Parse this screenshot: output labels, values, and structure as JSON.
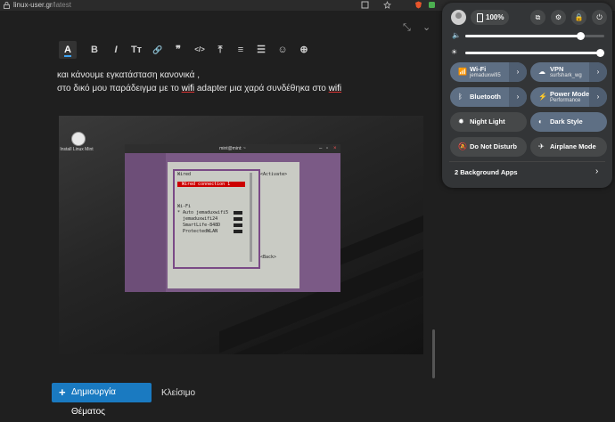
{
  "browser": {
    "url_host": "linux-user.gr",
    "url_path": "/latest"
  },
  "editor": {
    "toolbar": [
      {
        "name": "heading-button",
        "glyph": "A",
        "active": true
      },
      {
        "name": "bold-button",
        "glyph": "B"
      },
      {
        "name": "italic-button",
        "glyph": "I"
      },
      {
        "name": "font-size-button",
        "glyph": "Tт"
      },
      {
        "name": "link-button",
        "glyph": "🔗"
      },
      {
        "name": "quote-button",
        "glyph": "❞"
      },
      {
        "name": "code-button",
        "glyph": "</>"
      },
      {
        "name": "upload-button",
        "glyph": "⤒"
      },
      {
        "name": "bullet-list-button",
        "glyph": "≡"
      },
      {
        "name": "numbered-list-button",
        "glyph": "☰"
      },
      {
        "name": "emoji-button",
        "glyph": "☺"
      },
      {
        "name": "more-button",
        "glyph": "⊕"
      }
    ],
    "line1": "και κάνουμε εγκατάσταση κανονικά  ,",
    "line2_prefix": "στο δικό μου παράδειγμα με το ",
    "line2_link1": "wifi",
    "line2_mid": " adapter μια χαρά συνδέθηκα στο ",
    "line2_link2": "wifi"
  },
  "screenshot": {
    "desktop_icon_label": "Install Linux Mint",
    "terminal_title": "mint@mint: ~",
    "tui_wired": "Wired",
    "tui_selected": "Wired connection 1",
    "tui_activate": "<Activate>",
    "tui_wifi_header": "Wi-Fi",
    "tui_networks": [
      "* Auto jemaduxwifi5",
      "  jemaduxwifi24",
      "  SmartLife-848D",
      "  ProtectedWLAN"
    ],
    "tui_back": "<Back>"
  },
  "footer": {
    "create_label": "Δημιουργία Θέματος",
    "close_label": "Κλείσιμο"
  },
  "quick_settings": {
    "battery": "100%",
    "volume_level": 0.83,
    "brightness_level": 1.0,
    "tiles": [
      {
        "name": "wifi",
        "label": "Wi-Fi",
        "sub": "jemaduxwifi5",
        "on": true,
        "arrow": true,
        "icon": "wifi-icon"
      },
      {
        "name": "vpn",
        "label": "VPN",
        "sub": "surfshark_wg",
        "on": true,
        "arrow": true,
        "icon": "vpn-icon"
      },
      {
        "name": "bluetooth",
        "label": "Bluetooth",
        "sub": "",
        "on": true,
        "arrow": true,
        "icon": "bluetooth-icon"
      },
      {
        "name": "power-mode",
        "label": "Power Mode",
        "sub": "Performance",
        "on": true,
        "arrow": true,
        "icon": "power-mode-icon"
      },
      {
        "name": "night-light",
        "label": "Night Light",
        "sub": "",
        "on": false,
        "arrow": false,
        "icon": "night-light-icon"
      },
      {
        "name": "dark-style",
        "label": "Dark Style",
        "sub": "",
        "on": true,
        "arrow": false,
        "icon": "dark-style-icon"
      },
      {
        "name": "do-not-disturb",
        "label": "Do Not Disturb",
        "sub": "",
        "on": false,
        "arrow": false,
        "icon": "bell-off-icon"
      },
      {
        "name": "airplane-mode",
        "label": "Airplane Mode",
        "sub": "",
        "on": false,
        "arrow": false,
        "icon": "airplane-icon"
      }
    ],
    "background_apps": "2 Background Apps"
  },
  "colors": {
    "accent_button": "#1a7ac1",
    "tile_on": "#5e6f84",
    "tile_off": "#464849"
  }
}
